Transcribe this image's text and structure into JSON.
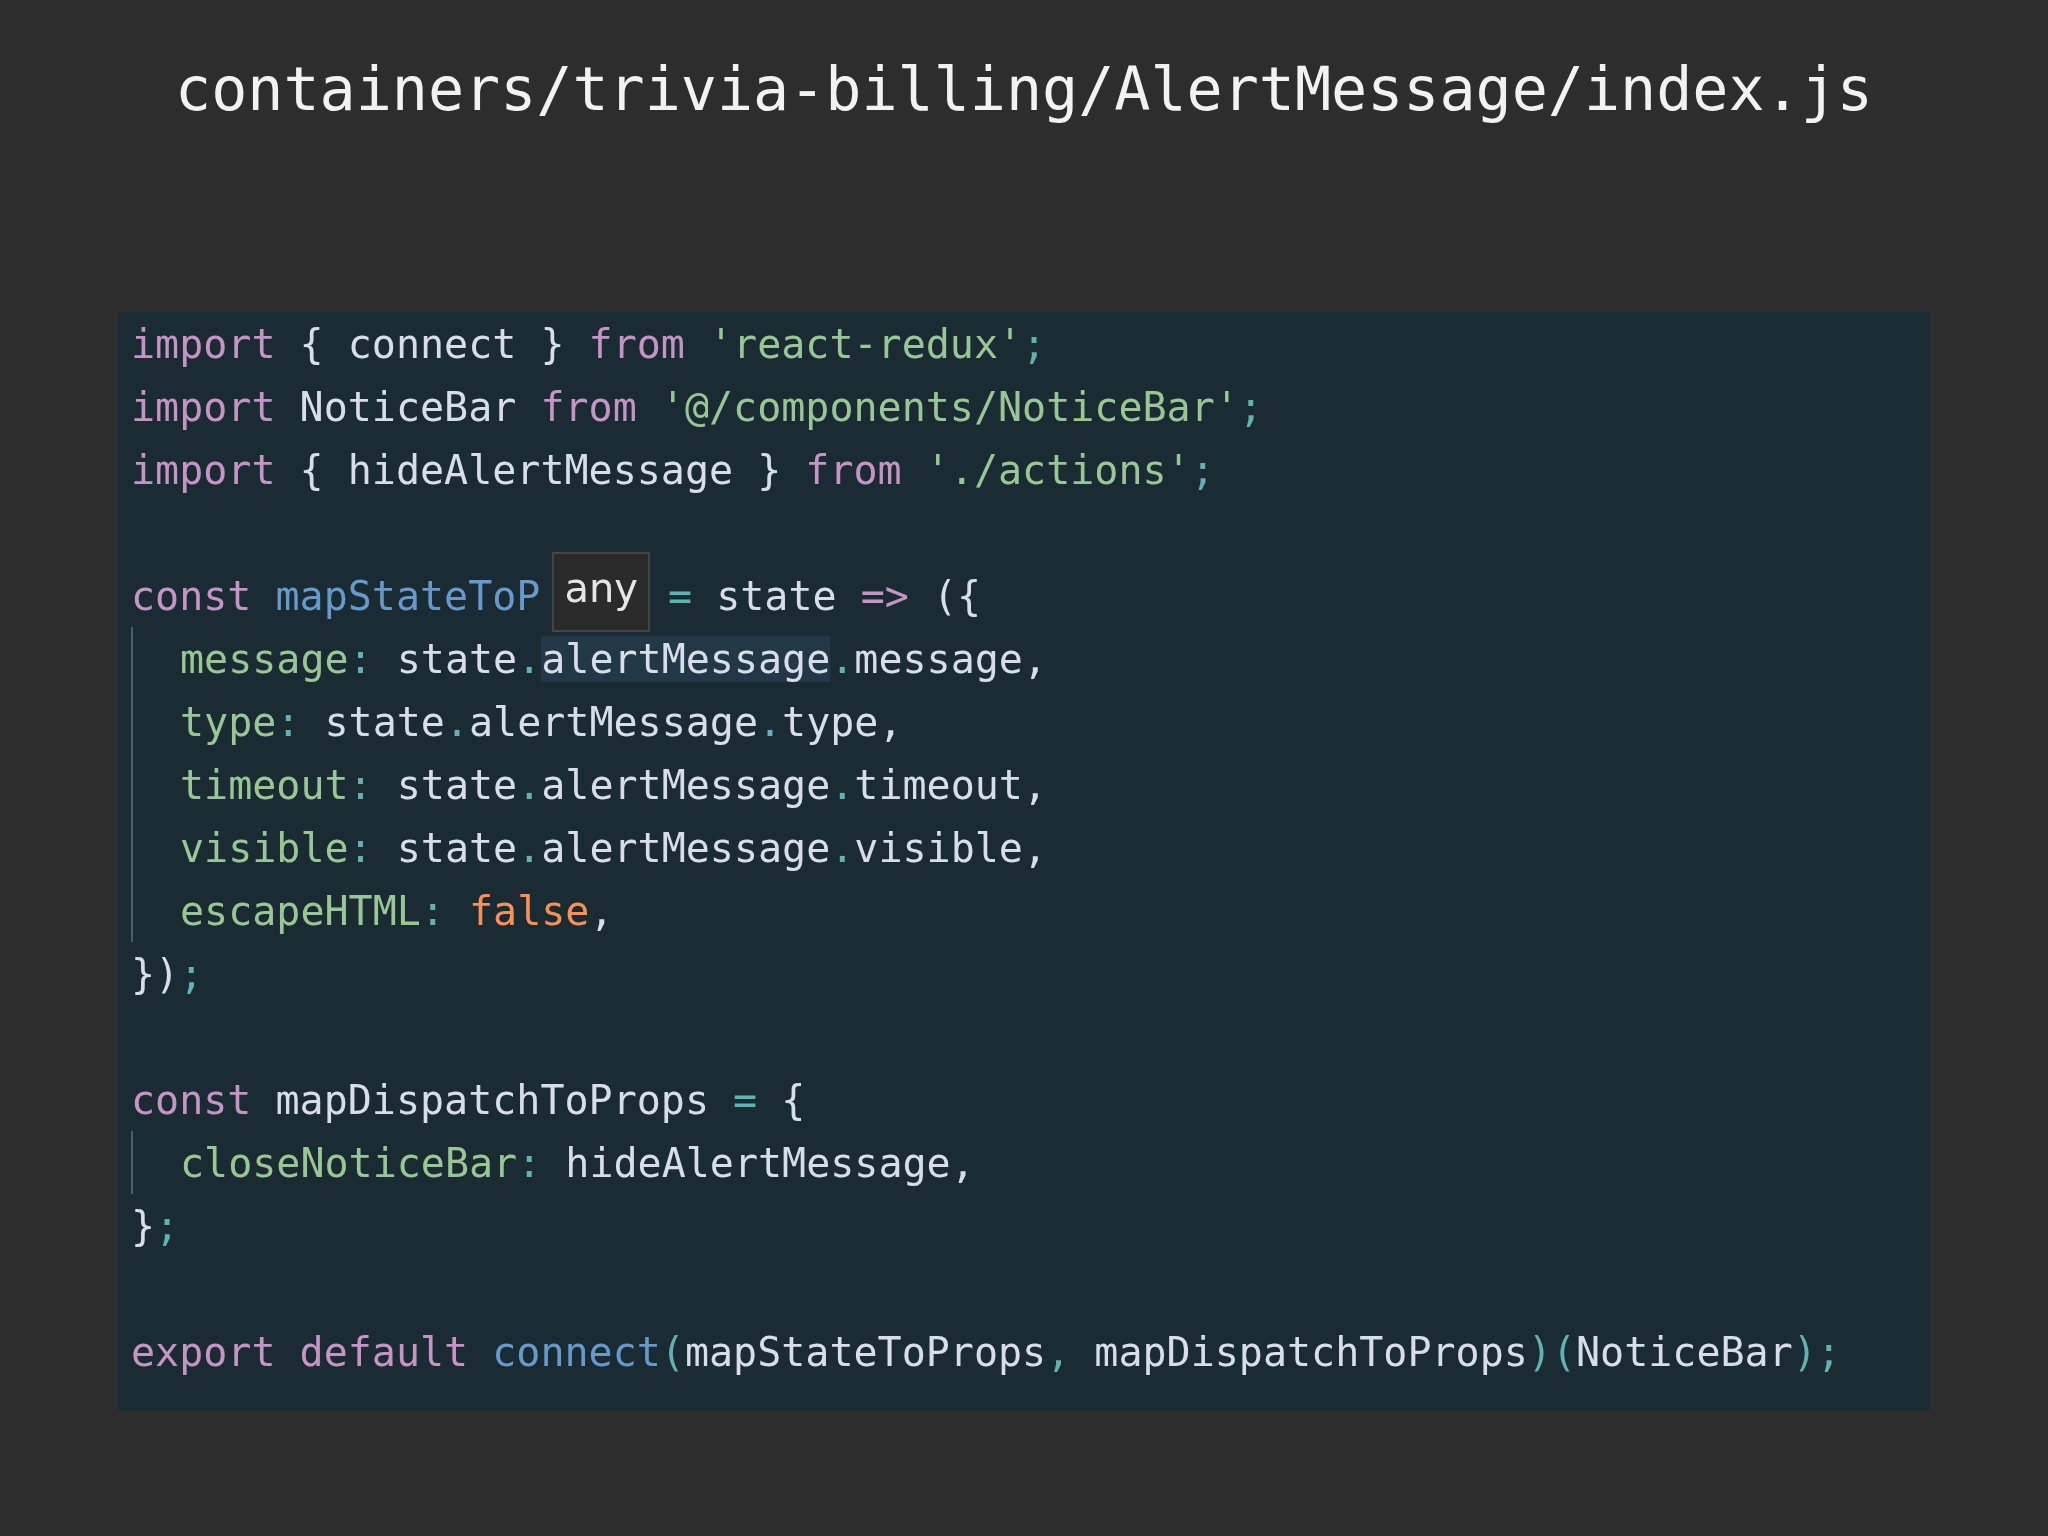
{
  "title": "containers/trivia-billing/AlertMessage/index.js",
  "code": {
    "lines": [
      {
        "tokens": [
          {
            "kind": "keyword",
            "text": "import"
          },
          {
            "kind": "plain",
            "text": " { connect } "
          },
          {
            "kind": "keyword",
            "text": "from "
          },
          {
            "kind": "string",
            "text": "'react-redux'"
          },
          {
            "kind": "punct",
            "text": ";"
          }
        ]
      },
      {
        "tokens": [
          {
            "kind": "keyword",
            "text": "import"
          },
          {
            "kind": "plain",
            "text": " NoticeBar "
          },
          {
            "kind": "keyword",
            "text": "from "
          },
          {
            "kind": "string",
            "text": "'@/components/NoticeBar'"
          },
          {
            "kind": "punct",
            "text": ";"
          }
        ]
      },
      {
        "tokens": [
          {
            "kind": "keyword",
            "text": "import"
          },
          {
            "kind": "plain",
            "text": " { hideAlertMessage } "
          },
          {
            "kind": "keyword",
            "text": "from "
          },
          {
            "kind": "string",
            "text": "'./actions'"
          },
          {
            "kind": "punct",
            "text": ";"
          }
        ]
      },
      {
        "blank": true
      },
      {
        "tokens": [
          {
            "kind": "keyword",
            "text": "const "
          },
          {
            "kind": "func",
            "text": "mapStateToP"
          },
          {
            "kind": "tooltip",
            "text": "any"
          },
          {
            "kind": "punct",
            "text": "="
          },
          {
            "kind": "plain",
            "text": " state "
          },
          {
            "kind": "keyword",
            "text": "=>"
          },
          {
            "kind": "plain",
            "text": " ({"
          }
        ]
      },
      {
        "indent": true,
        "tokens": [
          {
            "kind": "prop",
            "text": "message"
          },
          {
            "kind": "punct",
            "text": ":"
          },
          {
            "kind": "plain",
            "text": " state"
          },
          {
            "kind": "punct",
            "text": "."
          },
          {
            "kind": "highlight",
            "text": "alertMessage"
          },
          {
            "kind": "punct",
            "text": "."
          },
          {
            "kind": "plain",
            "text": "message,"
          }
        ]
      },
      {
        "indent": true,
        "tokens": [
          {
            "kind": "prop",
            "text": "type"
          },
          {
            "kind": "punct",
            "text": ":"
          },
          {
            "kind": "plain",
            "text": " state"
          },
          {
            "kind": "punct",
            "text": "."
          },
          {
            "kind": "plain",
            "text": "alertMessage"
          },
          {
            "kind": "punct",
            "text": "."
          },
          {
            "kind": "plain",
            "text": "type,"
          }
        ]
      },
      {
        "indent": true,
        "tokens": [
          {
            "kind": "prop",
            "text": "timeout"
          },
          {
            "kind": "punct",
            "text": ":"
          },
          {
            "kind": "plain",
            "text": " state"
          },
          {
            "kind": "punct",
            "text": "."
          },
          {
            "kind": "plain",
            "text": "alertMessage"
          },
          {
            "kind": "punct",
            "text": "."
          },
          {
            "kind": "plain",
            "text": "timeout,"
          }
        ]
      },
      {
        "indent": true,
        "tokens": [
          {
            "kind": "prop",
            "text": "visible"
          },
          {
            "kind": "punct",
            "text": ":"
          },
          {
            "kind": "plain",
            "text": " state"
          },
          {
            "kind": "punct",
            "text": "."
          },
          {
            "kind": "plain",
            "text": "alertMessage"
          },
          {
            "kind": "punct",
            "text": "."
          },
          {
            "kind": "plain",
            "text": "visible,"
          }
        ]
      },
      {
        "indent": true,
        "tokens": [
          {
            "kind": "prop",
            "text": "escapeHTML"
          },
          {
            "kind": "punct",
            "text": ": "
          },
          {
            "kind": "bool",
            "text": "false"
          },
          {
            "kind": "plain",
            "text": ","
          }
        ]
      },
      {
        "tokens": [
          {
            "kind": "plain",
            "text": "})"
          },
          {
            "kind": "punct",
            "text": ";"
          }
        ]
      },
      {
        "blank": true
      },
      {
        "tokens": [
          {
            "kind": "keyword",
            "text": "const"
          },
          {
            "kind": "plain",
            "text": " mapDispatchToProps "
          },
          {
            "kind": "punct",
            "text": "="
          },
          {
            "kind": "plain",
            "text": " {"
          }
        ]
      },
      {
        "indent": true,
        "tokens": [
          {
            "kind": "prop",
            "text": "closeNoticeBar"
          },
          {
            "kind": "punct",
            "text": ":"
          },
          {
            "kind": "plain",
            "text": " hideAlertMessage,"
          }
        ]
      },
      {
        "tokens": [
          {
            "kind": "plain",
            "text": "}"
          },
          {
            "kind": "punct",
            "text": ";"
          }
        ]
      },
      {
        "blank": true
      },
      {
        "tokens": [
          {
            "kind": "keyword",
            "text": "export "
          },
          {
            "kind": "keyword",
            "text": "default "
          },
          {
            "kind": "func",
            "text": "connect"
          },
          {
            "kind": "punct",
            "text": "("
          },
          {
            "kind": "plain",
            "text": "mapStateToProps"
          },
          {
            "kind": "punct",
            "text": ", "
          },
          {
            "kind": "plain",
            "text": "mapDispatchToProps"
          },
          {
            "kind": "punct",
            "text": ")("
          },
          {
            "kind": "plain",
            "text": "NoticeBar"
          },
          {
            "kind": "punct",
            "text": ");"
          }
        ]
      }
    ]
  }
}
